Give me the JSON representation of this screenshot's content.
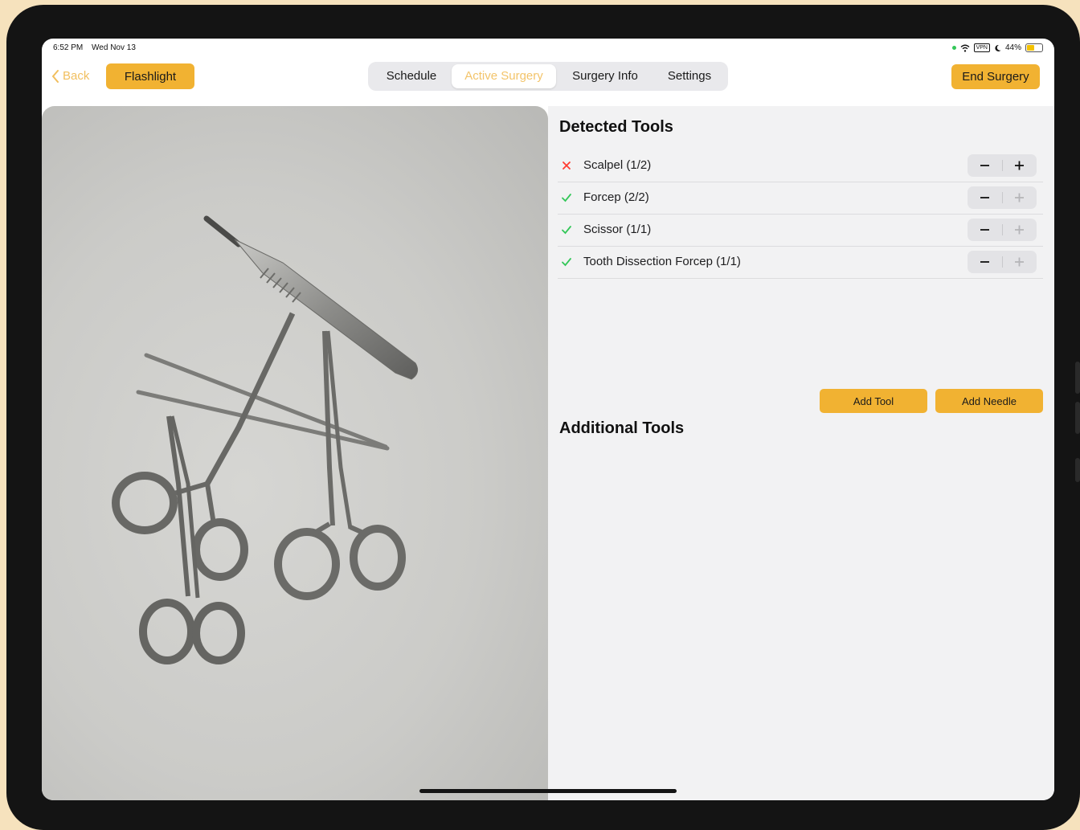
{
  "status_bar": {
    "time": "6:52 PM",
    "date": "Wed Nov 13",
    "vpn": "VPN",
    "battery": "44%"
  },
  "nav": {
    "back_label": "Back",
    "flashlight_label": "Flashlight",
    "tabs": [
      {
        "label": "Schedule",
        "active": false
      },
      {
        "label": "Active Surgery",
        "active": true
      },
      {
        "label": "Surgery Info",
        "active": false
      },
      {
        "label": "Settings",
        "active": false
      }
    ],
    "end_label": "End Surgery"
  },
  "detected": {
    "title": "Detected Tools",
    "tools": [
      {
        "label": "Scalpel (1/2)",
        "status": "missing",
        "icon": "x-icon"
      },
      {
        "label": "Forcep (2/2)",
        "status": "complete",
        "icon": "checkmark-icon"
      },
      {
        "label": "Scissor (1/1)",
        "status": "complete",
        "icon": "checkmark-icon"
      },
      {
        "label": "Tooth Dissection Forcep (1/1)",
        "status": "complete",
        "icon": "checkmark-icon"
      }
    ]
  },
  "additional": {
    "title": "Additional Tools",
    "add_tool_label": "Add Tool",
    "add_needle_label": "Add Needle"
  },
  "colors": {
    "accent": "#f1b232",
    "accent_text": "#f3c46a",
    "missing": "#ff3b30",
    "complete": "#34c759"
  }
}
